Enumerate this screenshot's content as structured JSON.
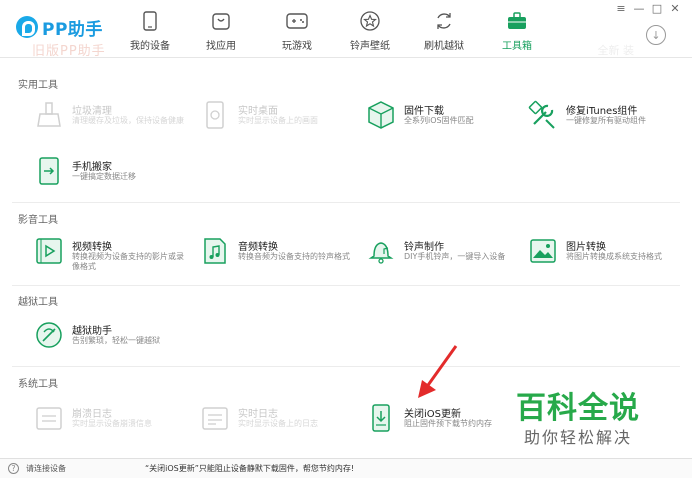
{
  "app": {
    "name": "PP助手",
    "ghost_logo": "旧版PP助手",
    "ghost_right": "全新 装"
  },
  "nav": [
    {
      "label": "我的设备",
      "icon": "phone-icon"
    },
    {
      "label": "找应用",
      "icon": "app-bag-icon"
    },
    {
      "label": "玩游戏",
      "icon": "gamepad-icon"
    },
    {
      "label": "铃声壁纸",
      "icon": "star-icon"
    },
    {
      "label": "刷机越狱",
      "icon": "refresh-icon"
    },
    {
      "label": "工具箱",
      "icon": "toolbox-icon",
      "active": true
    }
  ],
  "window_controls": {
    "menu": "≡",
    "min": "—",
    "max": "□",
    "close": "✕"
  },
  "download_symbol": "↓",
  "sections": {
    "practical": {
      "title": "实用工具",
      "tools": [
        {
          "name": "垃圾清理",
          "desc": "清理缓存及垃圾，保持设备健康",
          "disabled": true
        },
        {
          "name": "实时桌面",
          "desc": "实时显示设备上的画面",
          "disabled": true
        },
        {
          "name": "固件下载",
          "desc": "全系列iOS固件匹配",
          "disabled": false
        },
        {
          "name": "修复iTunes组件",
          "desc": "一键修复所有驱动组件",
          "disabled": false
        },
        {
          "name": "手机搬家",
          "desc": "一键搞定数据迁移",
          "disabled": false
        }
      ]
    },
    "media": {
      "title": "影音工具",
      "tools": [
        {
          "name": "视频转换",
          "desc": "转换视频为设备支持的影片或录像格式",
          "disabled": false
        },
        {
          "name": "音频转换",
          "desc": "转换音频为设备支持的铃声格式",
          "disabled": false
        },
        {
          "name": "铃声制作",
          "desc": "DIY手机铃声，一键导入设备",
          "disabled": false
        },
        {
          "name": "图片转换",
          "desc": "将图片转换成系统支持格式",
          "disabled": false
        }
      ]
    },
    "jailbreak": {
      "title": "越狱工具",
      "tools": [
        {
          "name": "越狱助手",
          "desc": "告别繁琐，轻松一键越狱",
          "disabled": false
        }
      ]
    },
    "system": {
      "title": "系统工具",
      "tools": [
        {
          "name": "崩溃日志",
          "desc": "实时显示设备崩溃信息",
          "disabled": true
        },
        {
          "name": "实时日志",
          "desc": "实时显示设备上的日志",
          "disabled": true
        },
        {
          "name": "关闭iOS更新",
          "desc": "阻止固件预下载节约内存",
          "disabled": false
        }
      ]
    }
  },
  "watermark": {
    "line1": "百科全说",
    "line2": "助你轻松解决"
  },
  "status": {
    "help_icon": "?",
    "left": "请连接设备",
    "message": "“关闭iOS更新”只能阻止设备静默下载固件，帮您节约内存!"
  },
  "colors": {
    "brand": "#1a9be0",
    "accent_green": "#18a05e",
    "arrow_red": "#e32b2b"
  }
}
